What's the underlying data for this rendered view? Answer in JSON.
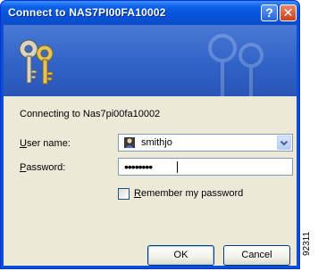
{
  "window": {
    "title": "Connect to NAS7PI00FA10002",
    "help_label": "?",
    "close_label": "✕"
  },
  "banner": {
    "icon": "keys-icon",
    "colors": {
      "start": "#4a79d4",
      "end": "#2955b7"
    }
  },
  "content": {
    "connecting_text": "Connecting to Nas7pi00fa10002"
  },
  "form": {
    "username_label_accel": "U",
    "username_label_rest": "ser name:",
    "username_value": "smithjo",
    "password_label_accel": "P",
    "password_label_rest": "assword:",
    "password_value": "••••••••",
    "remember_accel": "R",
    "remember_rest": "emember my password",
    "remember_checked": false
  },
  "buttons": {
    "ok": "OK",
    "cancel": "Cancel"
  },
  "side_code": "92311",
  "colors": {
    "titlebar": "#0652d9",
    "dialog_bg": "#ece9d8",
    "input_border": "#7f9db9",
    "close_button": "#c8401e"
  }
}
